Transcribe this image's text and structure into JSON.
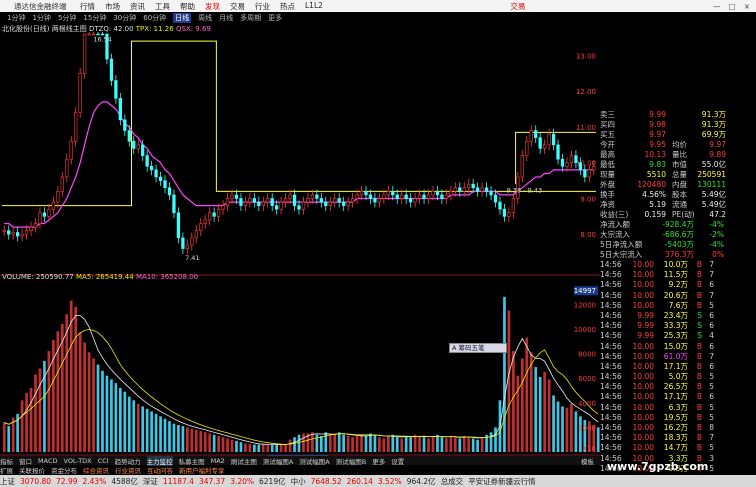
{
  "menubar": {
    "app_title": "通达信金融终端",
    "items": [
      {
        "label": "行情",
        "hot": false
      },
      {
        "label": "市场",
        "hot": false
      },
      {
        "label": "资讯",
        "hot": false
      },
      {
        "label": "工具",
        "hot": false
      },
      {
        "label": "帮助",
        "hot": false
      },
      {
        "label": "发现",
        "hot": true
      },
      {
        "label": "交易",
        "hot": false
      },
      {
        "label": "行业",
        "hot": false
      },
      {
        "label": "热点",
        "hot": false
      },
      {
        "label": "L1L2",
        "hot": false
      }
    ],
    "right_label": "交易",
    "window_buttons": [
      "—",
      "□",
      "×"
    ]
  },
  "period_tabs": {
    "items": [
      {
        "label": "1分钟",
        "active": false
      },
      {
        "label": "1分钟",
        "active": false
      },
      {
        "label": "5分钟",
        "active": false
      },
      {
        "label": "15分钟",
        "active": false
      },
      {
        "label": "30分钟",
        "active": false
      },
      {
        "label": "60分钟",
        "active": false
      },
      {
        "label": "日线",
        "active": true
      },
      {
        "label": "周线",
        "active": false
      },
      {
        "label": "月线",
        "active": false
      },
      {
        "label": "多周期",
        "active": false
      },
      {
        "label": "更多",
        "active": false
      }
    ]
  },
  "chart_header": {
    "stock": "北化股份(日线)",
    "indicator": "两根线主图",
    "dtzq": "DTZQ: 42.00",
    "tpx": "TPX: 11.26",
    "qsx": "QSX: 9.69"
  },
  "price_annotations": {
    "high": "16.54",
    "range": "14.00 - 13.83",
    "low": "7.41",
    "box": "9.38 - 9.43"
  },
  "price_axis": {
    "labels": [
      "13.00",
      "12.00",
      "11.00",
      "10.00",
      "9.00",
      "8.00"
    ]
  },
  "volume_header": {
    "volume": "VOLUME: 250590.77",
    "ma5": "MA5: 265419.44",
    "ma10": "MA10: 365208.00"
  },
  "volume_axis": {
    "badge": "14997",
    "labels": [
      "12000",
      "10000",
      "8000",
      "6000",
      "4000",
      "2000"
    ],
    "unit": "X10"
  },
  "popup": {
    "label": "A 筹码五笔"
  },
  "x_axis": {
    "left_date": "2022年",
    "cursor_date": "2022/05/11/三",
    "right_date": "11"
  },
  "chart_data": {
    "type": "bar",
    "title": "北化股份(日线)",
    "price_series": {
      "name": "K线",
      "ylim": [
        7.0,
        13.6
      ],
      "closes": [
        8.1,
        8.0,
        8.05,
        7.95,
        8.0,
        8.1,
        8.2,
        8.3,
        8.6,
        8.5,
        8.7,
        8.9,
        9.2,
        9.6,
        10.1,
        10.6,
        11.4,
        12.5,
        13.9,
        15.8,
        16.2,
        15.1,
        13.9,
        12.9,
        12.3,
        11.8,
        11.2,
        10.9,
        10.6,
        10.4,
        10.5,
        10.2,
        9.9,
        9.8,
        9.6,
        9.5,
        9.3,
        9.1,
        8.6,
        7.9,
        7.6,
        7.7,
        7.9,
        8.1,
        8.3,
        8.4,
        8.6,
        8.5,
        8.7,
        8.8,
        9.0,
        9.1,
        9.0,
        8.8,
        8.9,
        9.0,
        8.9,
        8.8,
        8.9,
        9.0,
        8.8,
        8.7,
        8.9,
        9.0,
        9.1,
        8.8,
        8.7,
        8.9,
        9.0,
        9.1,
        9.0,
        8.9,
        8.8,
        8.9,
        9.0,
        8.9,
        8.8,
        8.9,
        9.0,
        9.1,
        9.2,
        9.1,
        9.0,
        8.9,
        9.0,
        9.1,
        9.2,
        9.1,
        9.0,
        9.1,
        9.0,
        8.9,
        9.0,
        9.1,
        9.0,
        9.1,
        9.2,
        9.1,
        9.0,
        9.1,
        9.2,
        9.3,
        9.2,
        9.3,
        9.4,
        9.3,
        9.2,
        9.3,
        9.2,
        9.1,
        8.9,
        8.7,
        8.5,
        8.6,
        9.0,
        9.6,
        10.2,
        10.6,
        10.9,
        10.7,
        10.4,
        10.5,
        10.8,
        10.5,
        10.1,
        9.9,
        10.0,
        10.2,
        10.0,
        9.8,
        9.6,
        9.8,
        9.9
      ]
    },
    "ma_series": {
      "name": "均线",
      "values": [
        8.3,
        8.3,
        8.2,
        8.2,
        8.2,
        8.2,
        8.2,
        8.2,
        8.3,
        8.3,
        8.4,
        8.5,
        8.6,
        8.8,
        9.0,
        9.3,
        9.6,
        10.0,
        10.5,
        11.0,
        11.4,
        11.6,
        11.7,
        11.7,
        11.6,
        11.5,
        11.3,
        11.1,
        11.0,
        10.8,
        10.7,
        10.5,
        10.4,
        10.2,
        10.1,
        10.0,
        9.8,
        9.7,
        9.5,
        9.3,
        9.1,
        9.0,
        8.9,
        8.8,
        8.8,
        8.8,
        8.8,
        8.8,
        8.8,
        8.8,
        8.9,
        8.9,
        8.9,
        8.9,
        8.9,
        8.9,
        8.9,
        8.9,
        8.9,
        8.9,
        8.9,
        8.9,
        8.9,
        8.9,
        8.9,
        8.9,
        8.9,
        8.9,
        8.9,
        8.9,
        8.9,
        8.9,
        8.9,
        8.9,
        8.9,
        8.9,
        8.9,
        8.9,
        8.9,
        9.0,
        9.0,
        9.0,
        9.0,
        9.0,
        9.0,
        9.0,
        9.0,
        9.0,
        9.0,
        9.0,
        9.0,
        9.0,
        9.0,
        9.0,
        9.0,
        9.0,
        9.0,
        9.0,
        9.0,
        9.0,
        9.1,
        9.1,
        9.1,
        9.1,
        9.1,
        9.2,
        9.2,
        9.2,
        9.2,
        9.2,
        9.2,
        9.1,
        9.1,
        9.1,
        9.1,
        9.2,
        9.3,
        9.4,
        9.5,
        9.6,
        9.6,
        9.7,
        9.7,
        9.8,
        9.8,
        9.8,
        9.8,
        9.8,
        9.8,
        9.8,
        9.8,
        9.8,
        9.8
      ]
    },
    "volume_series": {
      "name": "VOLUME",
      "ylim": [
        0,
        13000
      ],
      "values": [
        2400,
        2100,
        2800,
        3100,
        4200,
        4800,
        5200,
        6300,
        6800,
        7400,
        8200,
        9100,
        9800,
        10400,
        11200,
        12300,
        11800,
        9700,
        8900,
        8100,
        7600,
        7100,
        6600,
        6200,
        5900,
        5600,
        5200,
        4900,
        4500,
        4200,
        3900,
        3700,
        3500,
        3300,
        3100,
        2900,
        2700,
        2500,
        2300,
        2200,
        2100,
        2000,
        1900,
        1800,
        1700,
        1600,
        1500,
        1400,
        1300,
        1200,
        1100,
        1000,
        900,
        800,
        700,
        650,
        600,
        600,
        600,
        600,
        600,
        600,
        600,
        600,
        1000,
        1200,
        1400,
        1500,
        1500,
        1600,
        1400,
        1300,
        1600,
        1400,
        1500,
        1600,
        1400,
        1300,
        1200,
        1300,
        1400,
        1300,
        1500,
        1400,
        1200,
        1100,
        1300,
        1400,
        1200,
        1100,
        1300,
        1200,
        1400,
        1300,
        1200,
        1100,
        1300,
        1400,
        1200,
        1100,
        1300,
        1200,
        1100,
        1300,
        1200,
        1100,
        1000,
        1200,
        1400,
        1600,
        2000,
        4200,
        12600,
        11500,
        8200,
        6200,
        7600,
        9300,
        8100,
        6900,
        6100,
        6500,
        5900,
        4600,
        4100,
        3700,
        3600,
        3900,
        3300,
        2900,
        2600,
        2500,
        2200,
        2000
      ]
    }
  },
  "quote_panel": {
    "rows": [
      {
        "l1": "卖三",
        "v1": "9.99",
        "c1": "red",
        "v1b": "91.3万",
        "c1b": "yel"
      },
      {
        "l1": "买四",
        "v1": "9.98",
        "c1": "red",
        "v1b": "91.3万",
        "c1b": "yel"
      },
      {
        "l1": "买五",
        "v1": "9.97",
        "c1": "red",
        "v1b": "69.9万",
        "c1b": "yel"
      }
    ],
    "stats": [
      {
        "l1": "今开",
        "v1": "9.95",
        "c1": "red",
        "l2": "均价",
        "v2": "9.97",
        "c2": "red"
      },
      {
        "l1": "最高",
        "v1": "10.13",
        "c1": "red",
        "l2": "量比",
        "v2": "9.89",
        "c2": "red"
      },
      {
        "l1": "最低",
        "v1": "9.83",
        "c1": "grn",
        "l2": "市值",
        "v2": "55.0亿",
        "c2": "wht"
      },
      {
        "l1": "现量",
        "v1": "5510",
        "c1": "yel",
        "l2": "总量",
        "v2": "250591",
        "c2": "yel"
      },
      {
        "l1": "外盘",
        "v1": "120480",
        "c1": "red",
        "l2": "内盘",
        "v2": "130111",
        "c2": "grn"
      },
      {
        "l1": "换手",
        "v1": "4.56%",
        "c1": "wht",
        "l2": "股本",
        "v2": "5.49亿",
        "c2": "wht"
      },
      {
        "l1": "净资",
        "v1": "5.19",
        "c1": "wht",
        "l2": "流通",
        "v2": "5.49亿",
        "c2": "wht"
      },
      {
        "l1": "收益(三)",
        "v1": "0.159",
        "c1": "wht",
        "l2": "PE(动)",
        "v2": "47.2",
        "c2": "wht"
      }
    ],
    "flows": [
      {
        "label": "净流入额",
        "value": "-928.4万",
        "pct": "-4%",
        "c": "grn"
      },
      {
        "label": "大宗流入",
        "value": "-686.6万",
        "pct": "-2%",
        "c": "grn"
      },
      {
        "label": "5日净流入额",
        "value": "-5403万",
        "pct": "-4%",
        "c": "grn"
      },
      {
        "label": "5日大宗流入",
        "value": "376.3万",
        "pct": "0%",
        "c": "red"
      }
    ],
    "ticks": [
      {
        "t": "14:56",
        "p": "10.00",
        "q": "10.0万",
        "qc": "yel",
        "d": "B",
        "dc": "red",
        "n": "7"
      },
      {
        "t": "14:56",
        "p": "10.00",
        "q": "11.5万",
        "qc": "yel",
        "d": "B",
        "dc": "red",
        "n": "7"
      },
      {
        "t": "14:56",
        "p": "10.00",
        "q": "9.2万",
        "qc": "yel",
        "d": "B",
        "dc": "red",
        "n": "6"
      },
      {
        "t": "14:56",
        "p": "10.00",
        "q": "20.6万",
        "qc": "yel",
        "d": "B",
        "dc": "red",
        "n": "7"
      },
      {
        "t": "14:56",
        "p": "10.00",
        "q": "7.6万",
        "qc": "yel",
        "d": "B",
        "dc": "red",
        "n": "5"
      },
      {
        "t": "14:56",
        "p": "9.99",
        "q": "23.4万",
        "qc": "yel",
        "d": "S",
        "dc": "grn",
        "n": "6"
      },
      {
        "t": "14:56",
        "p": "9.99",
        "q": "33.3万",
        "qc": "yel",
        "d": "S",
        "dc": "grn",
        "n": "6"
      },
      {
        "t": "14:56",
        "p": "9.99",
        "q": "25.3万",
        "qc": "yel",
        "d": "S",
        "dc": "grn",
        "n": "4"
      },
      {
        "t": "14:56",
        "p": "10.00",
        "q": "15.0万",
        "qc": "yel",
        "d": "B",
        "dc": "red",
        "n": "6"
      },
      {
        "t": "14:56",
        "p": "10.00",
        "q": "61.0万",
        "qc": "mag",
        "d": "B",
        "dc": "red",
        "n": "7"
      },
      {
        "t": "14:56",
        "p": "10.00",
        "q": "17.1万",
        "qc": "yel",
        "d": "B",
        "dc": "red",
        "n": "6"
      },
      {
        "t": "14:56",
        "p": "10.00",
        "q": "5.0万",
        "qc": "yel",
        "d": "B",
        "dc": "red",
        "n": "5"
      },
      {
        "t": "14:56",
        "p": "10.00",
        "q": "26.5万",
        "qc": "yel",
        "d": "B",
        "dc": "red",
        "n": "5"
      },
      {
        "t": "14:56",
        "p": "10.00",
        "q": "17.1万",
        "qc": "yel",
        "d": "B",
        "dc": "red",
        "n": "6"
      },
      {
        "t": "14:56",
        "p": "10.00",
        "q": "6.3万",
        "qc": "yel",
        "d": "B",
        "dc": "red",
        "n": "5"
      },
      {
        "t": "14:56",
        "p": "10.00",
        "q": "19.5万",
        "qc": "yel",
        "d": "B",
        "dc": "red",
        "n": "5"
      },
      {
        "t": "14:56",
        "p": "10.00",
        "q": "16.2万",
        "qc": "yel",
        "d": "B",
        "dc": "red",
        "n": "8"
      },
      {
        "t": "14:56",
        "p": "10.00",
        "q": "18.3万",
        "qc": "yel",
        "d": "B",
        "dc": "red",
        "n": "7"
      },
      {
        "t": "14:56",
        "p": "10.00",
        "q": "14.7万",
        "qc": "yel",
        "d": "B",
        "dc": "red",
        "n": "5"
      },
      {
        "t": "14:56",
        "p": "10.00",
        "q": "3.3万",
        "qc": "yel",
        "d": "B",
        "dc": "red",
        "n": "3"
      },
      {
        "t": "14:56",
        "p": "10.00",
        "q": "9.3万",
        "qc": "yel",
        "d": "B",
        "dc": "red",
        "n": "5"
      },
      {
        "t": "14:56",
        "p": "10.00",
        "q": "16.6万",
        "qc": "yel",
        "d": "B",
        "dc": "red",
        "n": "5"
      },
      {
        "t": "14:56",
        "p": "10.00",
        "q": "25.7万",
        "qc": "yel",
        "d": "B",
        "dc": "red",
        "n": "4"
      },
      {
        "t": "14:56",
        "p": "10.00",
        "q": "9.3万",
        "qc": "yel",
        "d": "B",
        "dc": "red",
        "n": "5"
      }
    ]
  },
  "bottom_tabs": {
    "row1": [
      "指标",
      "窗口",
      "MACD",
      "VOL-TDX",
      "CCI",
      "趋势动力",
      "主力监控",
      "私募主图",
      "MA2",
      "刷试主图",
      "测试幅图A",
      "测试幅图A",
      "测试幅图B",
      "更多",
      "设置"
    ],
    "row2": [
      "扩展",
      "关联报价",
      "资金分布",
      "综合资讯",
      "行业资讯",
      "互动问答",
      "新用户福利专享"
    ],
    "right_label": "模板"
  },
  "status_bar": {
    "items": [
      {
        "text": "上证",
        "c": "n"
      },
      {
        "text": "3070.80",
        "c": "r"
      },
      {
        "text": "72.99",
        "c": "r"
      },
      {
        "text": "2.43%",
        "c": "r"
      },
      {
        "text": "4588亿",
        "c": "n"
      },
      {
        "text": "深证",
        "c": "n"
      },
      {
        "text": "11187.4",
        "c": "r"
      },
      {
        "text": "347.37",
        "c": "r"
      },
      {
        "text": "3.20%",
        "c": "r"
      },
      {
        "text": "6219亿",
        "c": "n"
      },
      {
        "text": "中小",
        "c": "n"
      },
      {
        "text": "7648.52",
        "c": "r"
      },
      {
        "text": "260.14",
        "c": "r"
      },
      {
        "text": "3.52%",
        "c": "r"
      },
      {
        "text": "964.2亿",
        "c": "n"
      },
      {
        "text": "总成交",
        "c": "n"
      },
      {
        "text": "平安证券新疆云行情",
        "c": "n"
      }
    ]
  },
  "watermark": "www.7gpzb.com",
  "colors": {
    "up": "#ff3c3c",
    "down": "#3cffff",
    "ma": "#ff44ff",
    "box": "#ffff3c",
    "bg": "#000000"
  }
}
